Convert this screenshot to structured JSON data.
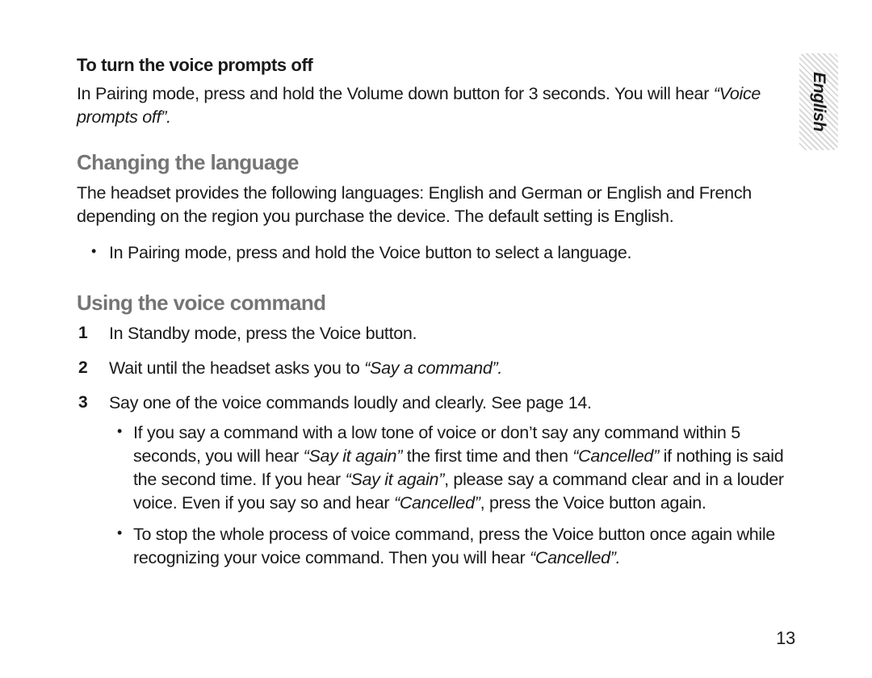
{
  "tab": {
    "language": "English"
  },
  "section_prompts_off": {
    "heading": "To turn the voice prompts off",
    "para_pre": "In Pairing mode, press and hold the Volume down button for 3 seconds. You will hear ",
    "para_quote": "“Voice prompts off”.",
    "para_post": ""
  },
  "section_language": {
    "title": "Changing the language",
    "para": "The headset provides the following languages: English and German or English and French depending on the region you purchase the device. The default setting is English.",
    "bullet": "In Pairing mode, press and hold the Voice button to select a language."
  },
  "section_voice_cmd": {
    "title": "Using the voice command",
    "step1": "In Standby mode, press the Voice button.",
    "step2_pre": "Wait until the headset asks you to ",
    "step2_quote": "“Say a command”.",
    "step3": "Say one of the voice  commands loudly and clearly. See page 14.",
    "sub1_a": "If you say a command with a low tone of voice or don’t say any command within 5 seconds, you will hear ",
    "sub1_q1": "“Say it again”",
    "sub1_b": " the first time and then ",
    "sub1_q2": "“Cancelled”",
    "sub1_c": " if nothing is said the second time. If you hear ",
    "sub1_q3": "“Say it again”",
    "sub1_d": ", please say a command clear and in a louder voice. Even if you say so and hear ",
    "sub1_q4": "“Cancelled”",
    "sub1_e": ", press the Voice button again.",
    "sub2_a": "To stop the whole process of voice command, press the Voice button once again while recognizing your voice command. Then you will hear ",
    "sub2_q1": "“Cancelled”.",
    "sub2_b": ""
  },
  "page_number": "13"
}
